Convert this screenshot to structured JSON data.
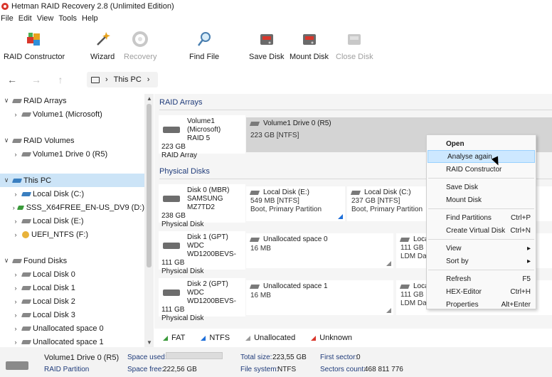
{
  "window": {
    "title": "Hetman RAID Recovery 2.8 (Unlimited Edition)"
  },
  "menu": [
    "File",
    "Edit",
    "View",
    "Tools",
    "Help"
  ],
  "toolbar": {
    "raid_constructor": "RAID Constructor",
    "wizard": "Wizard",
    "recovery": "Recovery",
    "find_file": "Find File",
    "save_disk": "Save Disk",
    "mount_disk": "Mount Disk",
    "close_disk": "Close Disk"
  },
  "breadcrumb": {
    "location": "This PC"
  },
  "tree": {
    "raid_arrays": "RAID Arrays",
    "volume1_ms": "Volume1 (Microsoft)",
    "raid_volumes": "RAID Volumes",
    "volume1_drive0": "Volume1 Drive 0 (R5)",
    "this_pc": "This PC",
    "local_c": "Local Disk (C:)",
    "sss": "SSS_X64FREE_EN-US_DV9 (D:)",
    "local_e": "Local Disk (E:)",
    "uefi": "UEFI_NTFS (F:)",
    "found_disks": "Found Disks",
    "found": [
      "Local Disk 0",
      "Local Disk 1",
      "Local Disk 2",
      "Local Disk 3",
      "Unallocated space 0",
      "Unallocated space 1"
    ]
  },
  "main": {
    "raid_section": "RAID Arrays",
    "raid_disk": {
      "name": "Volume1 (Microsoft)",
      "type": "RAID 5",
      "size": "223 GB",
      "kind": "RAID Array"
    },
    "raid_part": {
      "name": "Volume1 Drive 0 (R5)",
      "info": "223 GB [NTFS]"
    },
    "phys_section": "Physical Disks",
    "disk0": {
      "name": "Disk 0 (MBR)",
      "model": "SAMSUNG MZ7TD2",
      "size": "238 GB",
      "kind": "Physical Disk"
    },
    "disk0_p1": {
      "name": "Local Disk (E:)",
      "info": "549 MB [NTFS]",
      "desc": "Boot, Primary Partition"
    },
    "disk0_p2": {
      "name": "Local Disk (C:)",
      "info": "237 GB [NTFS]",
      "desc": "Boot, Primary Partition"
    },
    "disk1": {
      "name": "Disk 1 (GPT)",
      "model": "WDC WD1200BEVS-",
      "size": "111 GB",
      "kind": "Physical Disk"
    },
    "disk1_p1": {
      "name": "Unallocated space 0",
      "info": "16 MB"
    },
    "disk1_p2": {
      "name": "Loca",
      "info": "111 GB",
      "desc": "LDM Da"
    },
    "disk2": {
      "name": "Disk 2 (GPT)",
      "model": "WDC WD1200BEVS-",
      "size": "111 GB",
      "kind": "Physical Disk"
    },
    "disk2_p1": {
      "name": "Unallocated space 1",
      "info": "16 MB"
    },
    "disk2_p2": {
      "name": "Loca",
      "info": "111 GB",
      "desc": "LDM Data Partition"
    }
  },
  "legend": {
    "fat": "FAT",
    "ntfs": "NTFS",
    "unallocated": "Unallocated",
    "unknown": "Unknown",
    "colors": {
      "fat": "#3a9a3a",
      "ntfs": "#1e6fd9",
      "unallocated": "#9a9a9a",
      "unknown": "#d9362b"
    }
  },
  "status": {
    "name": "Volume1 Drive 0 (R5)",
    "type": "RAID Partition",
    "used_label": "Space used:",
    "free_label": "Space free:",
    "free_value": "222,56 GB",
    "total_label": "Total size:",
    "total_value": "223,55 GB",
    "fs_label": "File system:",
    "fs_value": "NTFS",
    "first_label": "First sector:",
    "first_value": "0",
    "count_label": "Sectors count:",
    "count_value": "468 811 776"
  },
  "context_menu": {
    "open": "Open",
    "analyse": "Analyse again",
    "raid": "RAID Constructor",
    "save": "Save Disk",
    "mount": "Mount Disk",
    "find": "Find Partitions",
    "find_key": "Ctrl+P",
    "virtual": "Create Virtual Disk",
    "virtual_key": "Ctrl+N",
    "view": "View",
    "sort": "Sort by",
    "refresh": "Refresh",
    "refresh_key": "F5",
    "hex": "HEX-Editor",
    "hex_key": "Ctrl+H",
    "props": "Properties",
    "props_key": "Alt+Enter"
  }
}
